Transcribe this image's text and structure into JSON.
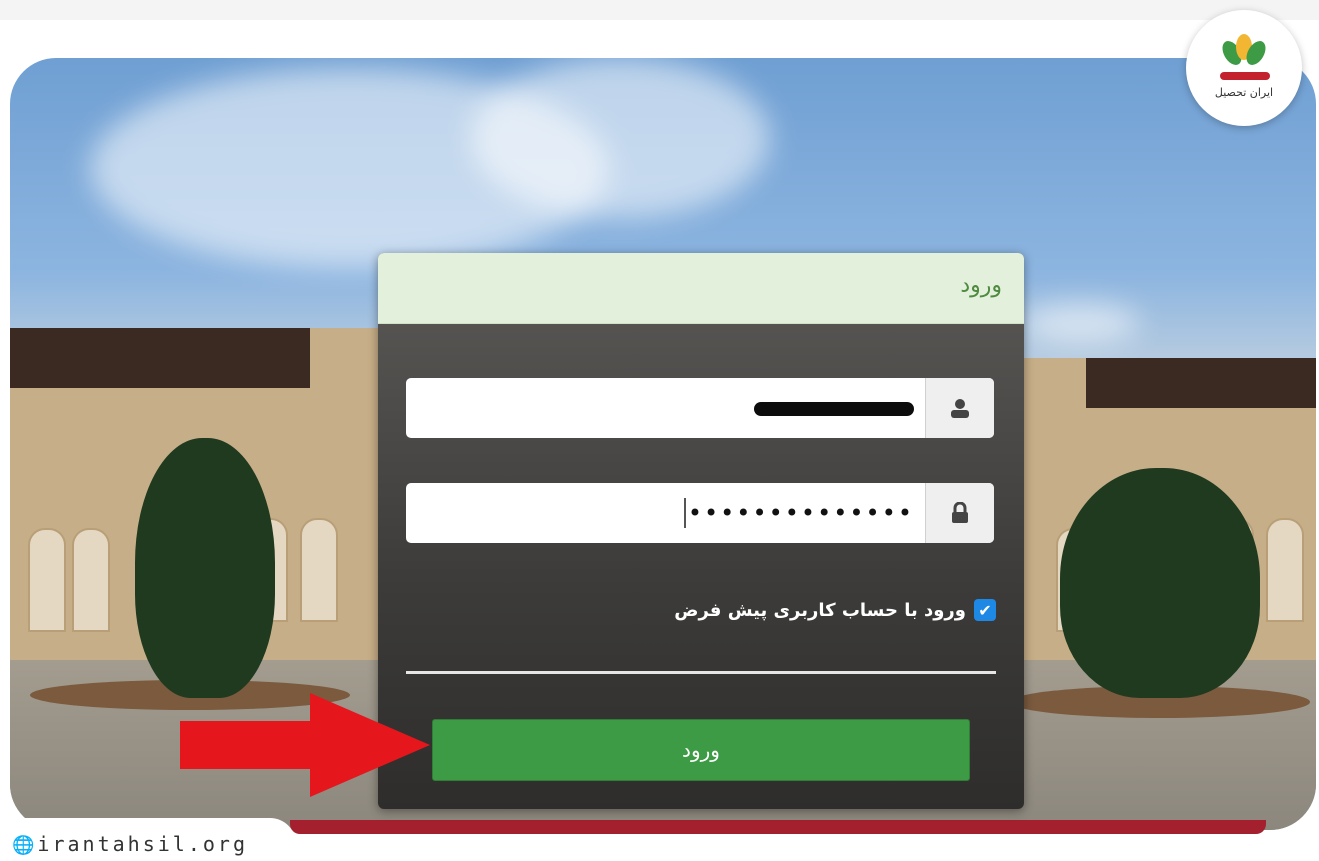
{
  "branding": {
    "logo_text": "ایران تحصیل",
    "site_url": "irantahsil.org",
    "colors": {
      "brand_red": "#a5202e",
      "accent_green": "#3d9a45",
      "header_green_bg": "#e3f1dc",
      "checkbox_blue": "#1e88e5"
    }
  },
  "login_panel": {
    "title": "ورود",
    "username": {
      "icon": "user-icon",
      "value": "redacted"
    },
    "password": {
      "icon": "lock-icon",
      "value": "••••••••••••••"
    },
    "remember": {
      "checked": true,
      "label": "ورود با حساب کاربری پیش فرض"
    },
    "submit_label": "ورود"
  },
  "annotation": {
    "icon": "red-arrow-icon"
  }
}
